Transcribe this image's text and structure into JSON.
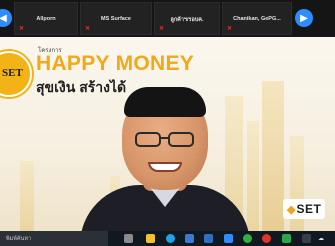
{
  "participants": [
    {
      "name": "Allporn"
    },
    {
      "name": "MS Surface"
    },
    {
      "name": "ลูกค้าฯ/รอบค."
    },
    {
      "name": "Chanikan, GePG..."
    }
  ],
  "slide": {
    "badge_text": "SET",
    "project_label": "โครงการ",
    "headline_en": "HAPPY MONEY",
    "headline_th": "สุขเงิน สร้างได้",
    "sponsor_mark": "◆",
    "sponsor_text": "SET"
  },
  "taskbar": {
    "search_placeholder": "พิมพ์ค้นหา",
    "tray_text": "☁"
  },
  "colors": {
    "accent_yellow": "#f2a818",
    "mute_red": "#e0342c",
    "nav_blue": "#2d8cff"
  }
}
